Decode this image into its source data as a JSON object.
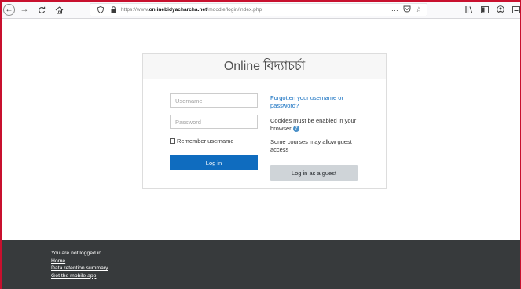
{
  "browser": {
    "url_prefix": "https://www.",
    "url_domain": "onlinebidyacharcha.net",
    "url_path": "/moodle/login/index.php",
    "more_actions": "···",
    "icons": [
      "back-icon",
      "forward-icon",
      "reload-icon",
      "home-icon",
      "shield-icon",
      "lock-icon",
      "pocket-icon",
      "bookmark-star-icon",
      "library-icon",
      "sidebar-icon",
      "account-icon",
      "reader-icon",
      "menu-icon"
    ]
  },
  "login": {
    "site_name_latin": "Online",
    "site_name_bengali": "বিদ্যাচর্চা",
    "username_placeholder": "Username",
    "password_placeholder": "Password",
    "remember_label": "Remember username",
    "login_button": "Log in",
    "forgot_link": "Forgotten your username or password?",
    "cookies_text": "Cookies must be enabled in your browser",
    "guest_note": "Some courses may allow guest access",
    "guest_button": "Log in as a guest"
  },
  "footer": {
    "status": "You are not logged in.",
    "links": [
      "Home",
      "Data retention summary",
      "Get the mobile app"
    ]
  },
  "colors": {
    "primary": "#0f6cbf",
    "footer_bg": "#373a3c",
    "frame_border": "#c8102e"
  }
}
